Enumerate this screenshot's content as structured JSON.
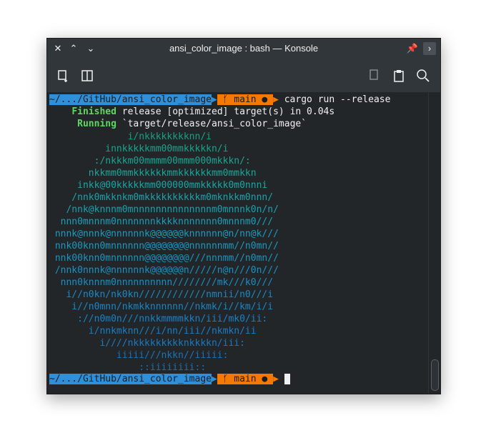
{
  "window": {
    "title": "ansi_color_image : bash — Konsole"
  },
  "titlebar_icons": [
    "close-icon",
    "minimize-icon",
    "maximize-icon",
    "pin-icon",
    "menu-icon"
  ],
  "toolbar_icons": [
    "new-tab-icon",
    "split-view-icon",
    "copy-icon",
    "paste-icon",
    "search-icon"
  ],
  "prompt": {
    "path": "~/.../GitHub/ansi_color_image",
    "branch": "main",
    "command": "cargo run --release"
  },
  "output": {
    "finished_label": "Finished",
    "finished_text": "release [optimized] target(s) in 0.04s",
    "running_label": "Running",
    "running_text": "`target/release/ansi_color_image`"
  },
  "art": [
    "              i/nkkkkkkkknn/i",
    "          innkkkkkmm00mmkkkkkn/i",
    "        :/nkkkm00mmmm00mmm000mkkkn/:",
    "       nkkmm0mmkkkkkkmmkkkkkkmm0mmkkn",
    "     inkk@00kkkkkmm000000mmkkkkk0m0nnni",
    "    /nnk0mkknkm0mkkkkkkkkkkm0mknkkm0nnn/",
    "   /nnk@knnnm0mnnnnnnnnnnnnnnm0mnnnk0n/n/",
    "  nnn0mnnnm0nnnnnnnkkkknnnnnnn0mnnnm0///",
    " nnnk@nnnk@nnnnnnk@@@@@@knnnnnn@n/nn@k///",
    " nnk00knn0mnnnnnn@@@@@@@@nnnnnnmm//n0mn//",
    " nnk00knn0mnnnnnn@@@@@@@@///nnnmm//n0mn//",
    " /nnk0nnnk@nnnnnnk@@@@@@n/////n@n///0n///",
    "  nnn0knnnm0nnnnnnnnnn////////mk///k0///",
    "   i//n0kn/nk0kn////////////nmnii/n0///i",
    "    i//n0mnn/nkmkknnnnnn//nkmk/i//km/i/i",
    "     ://n0m0n///nnkkmmmmkkn/iii/mk0/ii:",
    "       i/nnkmknn///i/nn/iii//nkmkn/ii",
    "         i////nkkkkkkkkknkkkkn/iii:",
    "            iiiii///nkkn//iiiii:",
    "                ::iiiiiiii::"
  ],
  "colors": {
    "art_rows": [
      "#16a085",
      "#17a589",
      "#1aa593",
      "#1aa69b",
      "#1aa6a3",
      "#1aa3aa",
      "#19a1b1",
      "#19a0b8",
      "#1a9dbd",
      "#1a99c0",
      "#1a95c2",
      "#1a92c4",
      "#1a8ec5",
      "#1a8ac6",
      "#1986c7",
      "#1982c6",
      "#197ec4",
      "#197ac0",
      "#1775bb",
      "#1670b4"
    ],
    "accent_blue": "#2f8fd8",
    "accent_orange": "#f57900"
  }
}
